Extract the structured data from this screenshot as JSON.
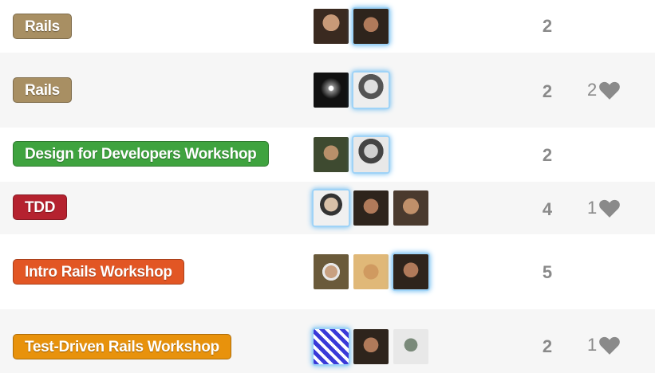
{
  "rows": [
    {
      "tag": "Rails",
      "tag_color": "#a88f63",
      "avatars": [
        "#5a4a3a",
        "#4a3528"
      ],
      "active": [
        1
      ],
      "count": "2",
      "likes": ""
    },
    {
      "tag": "Rails",
      "tag_color": "#a88f63",
      "avatars": [
        "#222222",
        "#cfcfcf"
      ],
      "active": [
        1
      ],
      "count": "2",
      "likes": "2"
    },
    {
      "tag": "Design for Developers Workshop",
      "tag_color": "#3fa33f",
      "avatars": [
        "#4e5a3a",
        "#d8d8d8"
      ],
      "active": [
        1
      ],
      "count": "2",
      "likes": ""
    },
    {
      "tag": "TDD",
      "tag_color": "#b5222f",
      "avatars": [
        "#e8e8e8",
        "#4a3528",
        "#6a5040"
      ],
      "active": [
        0
      ],
      "count": "4",
      "likes": "1"
    },
    {
      "tag": "Intro Rails Workshop",
      "tag_color": "#e25624",
      "avatars": [
        "#8a6a4a",
        "#c88a40",
        "#4a3528"
      ],
      "active": [
        2
      ],
      "count": "5",
      "likes": ""
    },
    {
      "tag": "Test-Driven Rails Workshop",
      "tag_color": "#e8920c",
      "avatars": [
        "#3a3ad8",
        "#4a3528",
        "#d8d8d8"
      ],
      "active": [
        0
      ],
      "count": "2",
      "likes": "1"
    }
  ]
}
